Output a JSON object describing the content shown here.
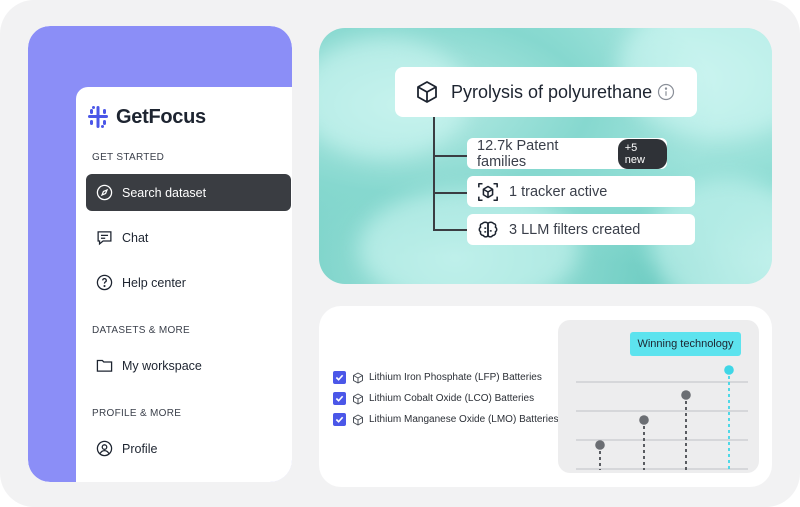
{
  "sidebar": {
    "brand": "GetFocus",
    "sections": {
      "get_started": "GET STARTED",
      "datasets": "DATASETS & MORE",
      "profile": "PROFILE & MORE"
    },
    "items": [
      {
        "label": "Search dataset",
        "icon": "compass-icon",
        "active": true
      },
      {
        "label": "Chat",
        "icon": "chat-icon"
      },
      {
        "label": "Help center",
        "icon": "question-icon"
      },
      {
        "label": "My workspace",
        "icon": "folder-icon"
      },
      {
        "label": "Profile",
        "icon": "user-icon"
      }
    ]
  },
  "hero": {
    "topic": "Pyrolysis of polyurethane",
    "stats": [
      {
        "label": "12.7k Patent families",
        "badge": "+5 new"
      },
      {
        "label": "1 tracker active"
      },
      {
        "label": "3 LLM filters created"
      }
    ]
  },
  "technologies": [
    {
      "label": "Lithium Iron Phosphate (LFP) Batteries",
      "checked": true
    },
    {
      "label": "Lithium Cobalt Oxide (LCO) Batteries",
      "checked": true
    },
    {
      "label": "Lithium Manganese Oxide (LMO) Batteries",
      "checked": true
    }
  ],
  "chart": {
    "label": "Winning technology",
    "colors": {
      "accent": "#5de3ee",
      "point": "#6b6e73",
      "highlight": "#3fd6e6"
    }
  },
  "chart_data": {
    "type": "scatter",
    "title": "Winning technology",
    "values": [
      1,
      2,
      3,
      4
    ],
    "ylim": [
      0,
      5
    ],
    "highlight_index": 3
  },
  "colors": {
    "purple": "#8b8ef7",
    "dark": "#3a3d42",
    "checkbox": "#4b57e8"
  }
}
